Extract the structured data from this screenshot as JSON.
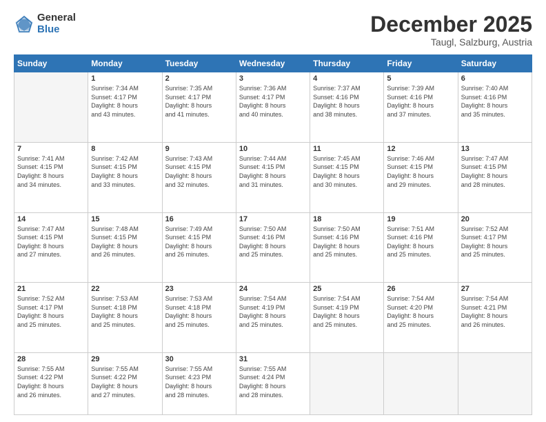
{
  "logo": {
    "general": "General",
    "blue": "Blue"
  },
  "header": {
    "month": "December 2025",
    "location": "Taugl, Salzburg, Austria"
  },
  "weekdays": [
    "Sunday",
    "Monday",
    "Tuesday",
    "Wednesday",
    "Thursday",
    "Friday",
    "Saturday"
  ],
  "weeks": [
    [
      {
        "day": "",
        "info": ""
      },
      {
        "day": "1",
        "info": "Sunrise: 7:34 AM\nSunset: 4:17 PM\nDaylight: 8 hours\nand 43 minutes."
      },
      {
        "day": "2",
        "info": "Sunrise: 7:35 AM\nSunset: 4:17 PM\nDaylight: 8 hours\nand 41 minutes."
      },
      {
        "day": "3",
        "info": "Sunrise: 7:36 AM\nSunset: 4:17 PM\nDaylight: 8 hours\nand 40 minutes."
      },
      {
        "day": "4",
        "info": "Sunrise: 7:37 AM\nSunset: 4:16 PM\nDaylight: 8 hours\nand 38 minutes."
      },
      {
        "day": "5",
        "info": "Sunrise: 7:39 AM\nSunset: 4:16 PM\nDaylight: 8 hours\nand 37 minutes."
      },
      {
        "day": "6",
        "info": "Sunrise: 7:40 AM\nSunset: 4:16 PM\nDaylight: 8 hours\nand 35 minutes."
      }
    ],
    [
      {
        "day": "7",
        "info": "Sunrise: 7:41 AM\nSunset: 4:15 PM\nDaylight: 8 hours\nand 34 minutes."
      },
      {
        "day": "8",
        "info": "Sunrise: 7:42 AM\nSunset: 4:15 PM\nDaylight: 8 hours\nand 33 minutes."
      },
      {
        "day": "9",
        "info": "Sunrise: 7:43 AM\nSunset: 4:15 PM\nDaylight: 8 hours\nand 32 minutes."
      },
      {
        "day": "10",
        "info": "Sunrise: 7:44 AM\nSunset: 4:15 PM\nDaylight: 8 hours\nand 31 minutes."
      },
      {
        "day": "11",
        "info": "Sunrise: 7:45 AM\nSunset: 4:15 PM\nDaylight: 8 hours\nand 30 minutes."
      },
      {
        "day": "12",
        "info": "Sunrise: 7:46 AM\nSunset: 4:15 PM\nDaylight: 8 hours\nand 29 minutes."
      },
      {
        "day": "13",
        "info": "Sunrise: 7:47 AM\nSunset: 4:15 PM\nDaylight: 8 hours\nand 28 minutes."
      }
    ],
    [
      {
        "day": "14",
        "info": "Sunrise: 7:47 AM\nSunset: 4:15 PM\nDaylight: 8 hours\nand 27 minutes."
      },
      {
        "day": "15",
        "info": "Sunrise: 7:48 AM\nSunset: 4:15 PM\nDaylight: 8 hours\nand 26 minutes."
      },
      {
        "day": "16",
        "info": "Sunrise: 7:49 AM\nSunset: 4:15 PM\nDaylight: 8 hours\nand 26 minutes."
      },
      {
        "day": "17",
        "info": "Sunrise: 7:50 AM\nSunset: 4:16 PM\nDaylight: 8 hours\nand 25 minutes."
      },
      {
        "day": "18",
        "info": "Sunrise: 7:50 AM\nSunset: 4:16 PM\nDaylight: 8 hours\nand 25 minutes."
      },
      {
        "day": "19",
        "info": "Sunrise: 7:51 AM\nSunset: 4:16 PM\nDaylight: 8 hours\nand 25 minutes."
      },
      {
        "day": "20",
        "info": "Sunrise: 7:52 AM\nSunset: 4:17 PM\nDaylight: 8 hours\nand 25 minutes."
      }
    ],
    [
      {
        "day": "21",
        "info": "Sunrise: 7:52 AM\nSunset: 4:17 PM\nDaylight: 8 hours\nand 25 minutes."
      },
      {
        "day": "22",
        "info": "Sunrise: 7:53 AM\nSunset: 4:18 PM\nDaylight: 8 hours\nand 25 minutes."
      },
      {
        "day": "23",
        "info": "Sunrise: 7:53 AM\nSunset: 4:18 PM\nDaylight: 8 hours\nand 25 minutes."
      },
      {
        "day": "24",
        "info": "Sunrise: 7:54 AM\nSunset: 4:19 PM\nDaylight: 8 hours\nand 25 minutes."
      },
      {
        "day": "25",
        "info": "Sunrise: 7:54 AM\nSunset: 4:19 PM\nDaylight: 8 hours\nand 25 minutes."
      },
      {
        "day": "26",
        "info": "Sunrise: 7:54 AM\nSunset: 4:20 PM\nDaylight: 8 hours\nand 25 minutes."
      },
      {
        "day": "27",
        "info": "Sunrise: 7:54 AM\nSunset: 4:21 PM\nDaylight: 8 hours\nand 26 minutes."
      }
    ],
    [
      {
        "day": "28",
        "info": "Sunrise: 7:55 AM\nSunset: 4:22 PM\nDaylight: 8 hours\nand 26 minutes."
      },
      {
        "day": "29",
        "info": "Sunrise: 7:55 AM\nSunset: 4:22 PM\nDaylight: 8 hours\nand 27 minutes."
      },
      {
        "day": "30",
        "info": "Sunrise: 7:55 AM\nSunset: 4:23 PM\nDaylight: 8 hours\nand 28 minutes."
      },
      {
        "day": "31",
        "info": "Sunrise: 7:55 AM\nSunset: 4:24 PM\nDaylight: 8 hours\nand 28 minutes."
      },
      {
        "day": "",
        "info": ""
      },
      {
        "day": "",
        "info": ""
      },
      {
        "day": "",
        "info": ""
      }
    ]
  ]
}
